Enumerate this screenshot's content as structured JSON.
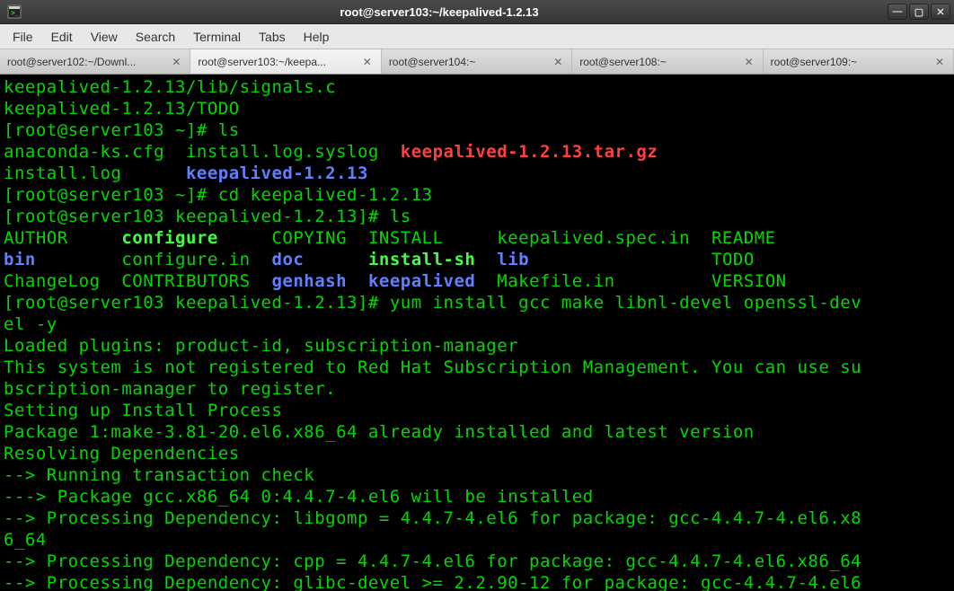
{
  "window": {
    "title": "root@server103:~/keepalived-1.2.13"
  },
  "menu": {
    "file": "File",
    "edit": "Edit",
    "view": "View",
    "search": "Search",
    "terminal": "Terminal",
    "tabs": "Tabs",
    "help": "Help"
  },
  "tabs": [
    {
      "label": "root@server102:~/Downl..."
    },
    {
      "label": "root@server103:~/keepa..."
    },
    {
      "label": "root@server104:~"
    },
    {
      "label": "root@server108:~"
    },
    {
      "label": "root@server109:~"
    }
  ],
  "term": {
    "l01": "keepalived-1.2.13/lib/signals.c",
    "l02": "keepalived-1.2.13/TODO",
    "l03p": "[root@server103 ~]# ",
    "l03c": "ls",
    "l04a": "anaconda-ks.cfg  install.log.syslog  ",
    "l04b": "keepalived-1.2.13.tar.gz",
    "l05a": "install.log      ",
    "l05b": "keepalived-1.2.13",
    "l06p": "[root@server103 ~]# ",
    "l06c": "cd keepalived-1.2.13",
    "l07p": "[root@server103 keepalived-1.2.13]# ",
    "l07c": "ls",
    "l08a": "AUTHOR     ",
    "l08b": "configure",
    "l08c": "     COPYING  INSTALL     keepalived.spec.in  README",
    "l09a": "bin",
    "l09b": "        configure.in  ",
    "l09c": "doc",
    "l09d": "      ",
    "l09e": "install-sh",
    "l09f": "  ",
    "l09g": "lib",
    "l09h": "                 TODO",
    "l10a": "ChangeLog  CONTRIBUTORS  ",
    "l10b": "genhash",
    "l10c": "  ",
    "l10d": "keepalived",
    "l10e": "  Makefile.in         VERSION",
    "l11p": "[root@server103 keepalived-1.2.13]# ",
    "l11c": "yum install gcc make libnl-devel openssl-dev",
    "l12": "el -y",
    "l13": "Loaded plugins: product-id, subscription-manager",
    "l14": "This system is not registered to Red Hat Subscription Management. You can use su",
    "l15": "bscription-manager to register.",
    "l16": "Setting up Install Process",
    "l17": "Package 1:make-3.81-20.el6.x86_64 already installed and latest version",
    "l18": "Resolving Dependencies",
    "l19": "--> Running transaction check",
    "l20": "---> Package gcc.x86_64 0:4.4.7-4.el6 will be installed",
    "l21": "--> Processing Dependency: libgomp = 4.4.7-4.el6 for package: gcc-4.4.7-4.el6.x8",
    "l22": "6_64",
    "l23": "--> Processing Dependency: cpp = 4.4.7-4.el6 for package: gcc-4.4.7-4.el6.x86_64",
    "l24": "--> Processing Dependency: glibc-devel >= 2.2.90-12 for package: gcc-4.4.7-4.el6"
  }
}
